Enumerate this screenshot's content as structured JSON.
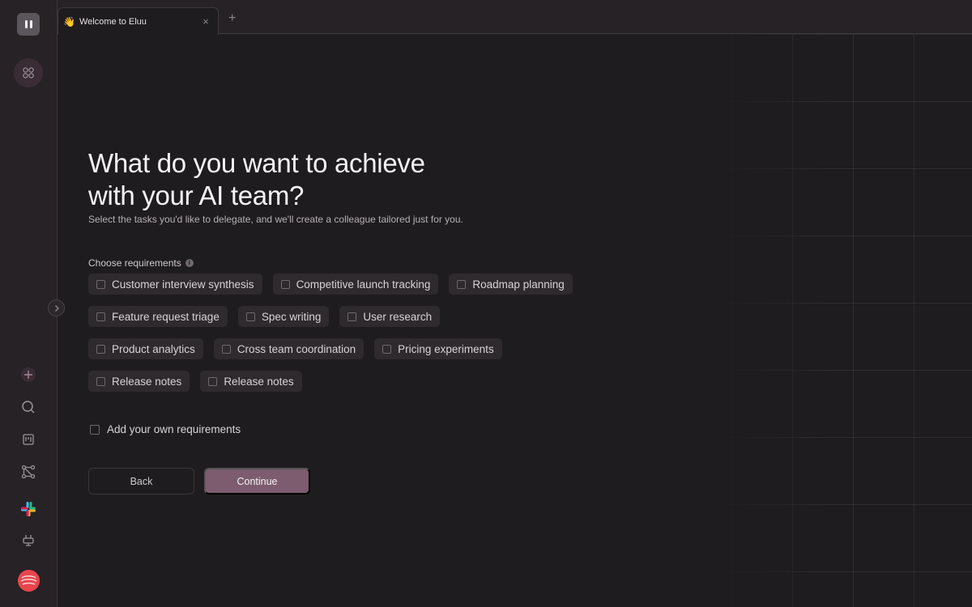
{
  "tab": {
    "emoji": "👋",
    "title": "Welcome to Eluu",
    "close": "×",
    "new_tab": "+"
  },
  "sidebar": {
    "icons": [
      "logo-icon",
      "apps-icon",
      "add-icon",
      "search-icon",
      "board-icon",
      "workflow-icon",
      "slack-icon",
      "plug-icon",
      "avatar"
    ]
  },
  "main": {
    "title": "What do you want to achieve with your AI team?",
    "subtitle": "Select the tasks you'd like to delegate, and we'll create a colleague tailored just for you.",
    "requirements_label": "Choose requirements",
    "info_glyph": "i",
    "rows": [
      [
        "Customer interview synthesis",
        "Competitive launch tracking",
        "Roadmap planning"
      ],
      [
        "Feature request triage",
        "Spec writing",
        "User research"
      ],
      [
        "Product analytics",
        "Cross team coordination",
        "Pricing experiments"
      ],
      [
        "Release notes",
        "Release notes"
      ]
    ],
    "own_requirements": "Add your own requirements",
    "back_label": "Back",
    "continue_label": "Continue"
  },
  "colors": {
    "background": "#1f1c1f",
    "rail": "#262226",
    "chip": "#2e2a2e",
    "accent": "#7c5c6e",
    "avatar": "#e8454d"
  }
}
